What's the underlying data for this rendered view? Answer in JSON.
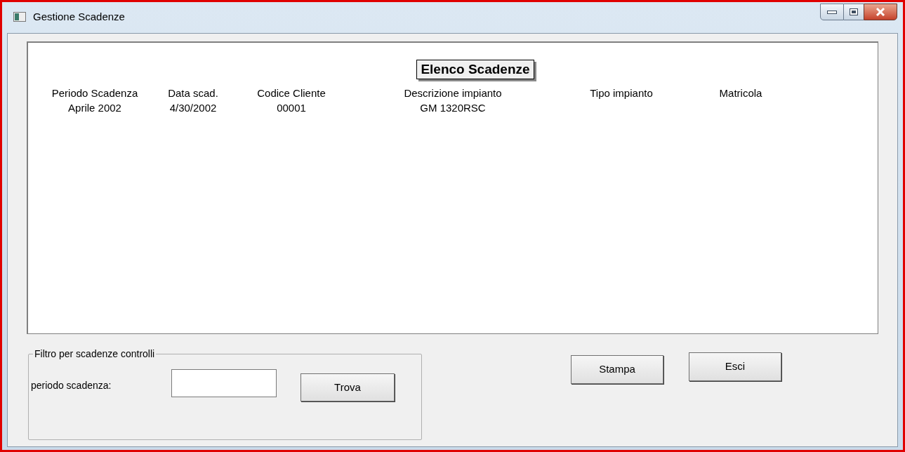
{
  "window": {
    "title": "Gestione Scadenze"
  },
  "list": {
    "title": "Elenco Scadenze",
    "columns": [
      "Periodo Scadenza",
      "Data scad.",
      "Codice Cliente",
      "Descrizione impianto",
      "Tipo impianto",
      "Matricola"
    ],
    "rows": [
      [
        "Aprile 2002",
        "4/30/2002",
        "00001",
        "GM 1320RSC",
        "",
        ""
      ]
    ]
  },
  "filter": {
    "legend": "Filtro per scadenze controlli",
    "label": "periodo scadenza:",
    "button": "Trova"
  },
  "buttons": [
    "Stampa",
    "Esci"
  ]
}
